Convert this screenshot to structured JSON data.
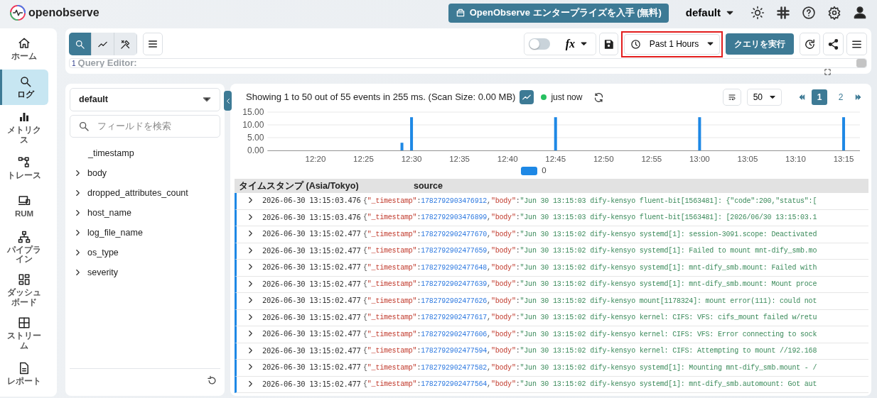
{
  "app": {
    "name": "openobserve"
  },
  "header": {
    "enterprise_button": "OpenObserve エンタープライズを入手 (無料)",
    "org": "default"
  },
  "sidebar": {
    "items": [
      {
        "label": "ホーム",
        "selected": false
      },
      {
        "label": "ログ",
        "selected": true
      },
      {
        "label": "メトリクス",
        "selected": false
      },
      {
        "label": "トレース",
        "selected": false
      },
      {
        "label": "RUM",
        "selected": false
      },
      {
        "label": "パイプライン",
        "selected": false
      },
      {
        "label": "ダッシュボード",
        "selected": false
      },
      {
        "label": "ストリーム",
        "selected": false
      },
      {
        "label": "レポート",
        "selected": false
      }
    ]
  },
  "toolbar": {
    "modes": [
      {
        "selected": true
      },
      {
        "selected": false
      },
      {
        "selected": false
      }
    ],
    "sql_mode": {
      "on": false
    },
    "function_label": "fx",
    "time_range": {
      "label": "Past 1 Hours",
      "highlighted": true
    },
    "run_button": "クエリを実行",
    "editor": {
      "line_number": "1",
      "placeholder": "Query Editor:"
    }
  },
  "fields": {
    "stream": "default",
    "search_placeholder": "フィールドを検索",
    "items": [
      {
        "name": "_timestamp",
        "expandable": false
      },
      {
        "name": "body",
        "expandable": true
      },
      {
        "name": "dropped_attributes_count",
        "expandable": true
      },
      {
        "name": "host_name",
        "expandable": true
      },
      {
        "name": "log_file_name",
        "expandable": true
      },
      {
        "name": "os_type",
        "expandable": true
      },
      {
        "name": "severity",
        "expandable": true
      }
    ]
  },
  "results": {
    "summary": "Showing 1 to 50 out of 55 events in 255 ms. (Scan Size: 0.00 MB)",
    "histogram_on": true,
    "status": "just now",
    "page_size": "50",
    "pages": [
      {
        "label": "1",
        "selected": true
      },
      {
        "label": "2",
        "selected": false
      }
    ],
    "chart_data": {
      "type": "bar",
      "categories": [
        null,
        null,
        null,
        null,
        null,
        "12:20",
        null,
        null,
        null,
        null,
        "12:25",
        null,
        null,
        null,
        null,
        "12:30",
        null,
        null,
        null,
        null,
        "12:35",
        null,
        null,
        null,
        null,
        "12:40",
        null,
        null,
        null,
        null,
        "12:45",
        null,
        null,
        null,
        null,
        "12:50",
        null,
        null,
        null,
        null,
        "12:55",
        null,
        null,
        null,
        null,
        "13:00",
        null,
        null,
        null,
        null,
        "13:05",
        null,
        null,
        null,
        null,
        "13:10",
        null,
        null,
        null,
        null,
        "13:15",
        null
      ],
      "series": [
        {
          "name": "0",
          "color": "#1e88e5",
          "values": [
            null,
            null,
            null,
            null,
            null,
            null,
            null,
            null,
            null,
            null,
            null,
            null,
            null,
            null,
            3,
            13,
            null,
            null,
            null,
            null,
            null,
            null,
            null,
            null,
            null,
            null,
            null,
            null,
            null,
            null,
            13,
            null,
            null,
            null,
            null,
            null,
            null,
            null,
            null,
            null,
            null,
            null,
            null,
            null,
            null,
            13,
            null,
            null,
            null,
            null,
            null,
            null,
            null,
            null,
            null,
            null,
            null,
            null,
            null,
            null,
            13,
            null
          ]
        }
      ],
      "ylim": [
        0,
        15
      ],
      "yticks": [
        {
          "value": 0,
          "label": "0.00"
        },
        {
          "value": 5,
          "label": "5.00"
        },
        {
          "value": 10,
          "label": "10.00"
        },
        {
          "value": 15,
          "label": "15.00"
        }
      ]
    },
    "table": {
      "columns": [
        "タイムスタンプ (Asia/Tokyo)",
        "source"
      ],
      "rows": [
        {
          "timestamp": "2026-06-30 13:15:03.476",
          "source": "{\"_timestamp\":1782792903476912,\"body\":\"Jun 30 13:15:03 dify-kensyo fluent-bit[1563481]: {\"code\":200,\"status\":["
        },
        {
          "timestamp": "2026-06-30 13:15:03.476",
          "source": "{\"_timestamp\":1782792903476899,\"body\":\"Jun 30 13:15:03 dify-kensyo fluent-bit[1563481]: [2026/06/30 13:15:03.1"
        },
        {
          "timestamp": "2026-06-30 13:15:02.477",
          "source": "{\"_timestamp\":1782792902477670,\"body\":\"Jun 30 13:15:02 dify-kensyo systemd[1]: session-3091.scope: Deactivated"
        },
        {
          "timestamp": "2026-06-30 13:15:02.477",
          "source": "{\"_timestamp\":1782792902477659,\"body\":\"Jun 30 13:15:02 dify-kensyo systemd[1]: Failed to mount mnt-dify_smb.mo"
        },
        {
          "timestamp": "2026-06-30 13:15:02.477",
          "source": "{\"_timestamp\":1782792902477648,\"body\":\"Jun 30 13:15:02 dify-kensyo systemd[1]: mnt-dify_smb.mount: Failed with"
        },
        {
          "timestamp": "2026-06-30 13:15:02.477",
          "source": "{\"_timestamp\":1782792902477639,\"body\":\"Jun 30 13:15:02 dify-kensyo systemd[1]: mnt-dify_smb.mount: Mount proce"
        },
        {
          "timestamp": "2026-06-30 13:15:02.477",
          "source": "{\"_timestamp\":1782792902477626,\"body\":\"Jun 30 13:15:02 dify-kensyo mount[1178324]: mount error(111): could not"
        },
        {
          "timestamp": "2026-06-30 13:15:02.477",
          "source": "{\"_timestamp\":1782792902477617,\"body\":\"Jun 30 13:15:02 dify-kensyo kernel: CIFS: VFS: cifs_mount failed w/retu"
        },
        {
          "timestamp": "2026-06-30 13:15:02.477",
          "source": "{\"_timestamp\":1782792902477606,\"body\":\"Jun 30 13:15:02 dify-kensyo kernel: CIFS: VFS: Error connecting to sock"
        },
        {
          "timestamp": "2026-06-30 13:15:02.477",
          "source": "{\"_timestamp\":1782792902477594,\"body\":\"Jun 30 13:15:02 dify-kensyo kernel: CIFS: Attempting to mount //192.168"
        },
        {
          "timestamp": "2026-06-30 13:15:02.477",
          "source": "{\"_timestamp\":1782792902477582,\"body\":\"Jun 30 13:15:02 dify-kensyo systemd[1]: Mounting mnt-dify_smb.mount - /"
        },
        {
          "timestamp": "2026-06-30 13:15:02.477",
          "source": "{\"_timestamp\":1782792902477564,\"body\":\"Jun 30 13:15:02 dify-kensyo systemd[1]: mnt-dify_smb.automount: Got aut"
        }
      ]
    }
  }
}
